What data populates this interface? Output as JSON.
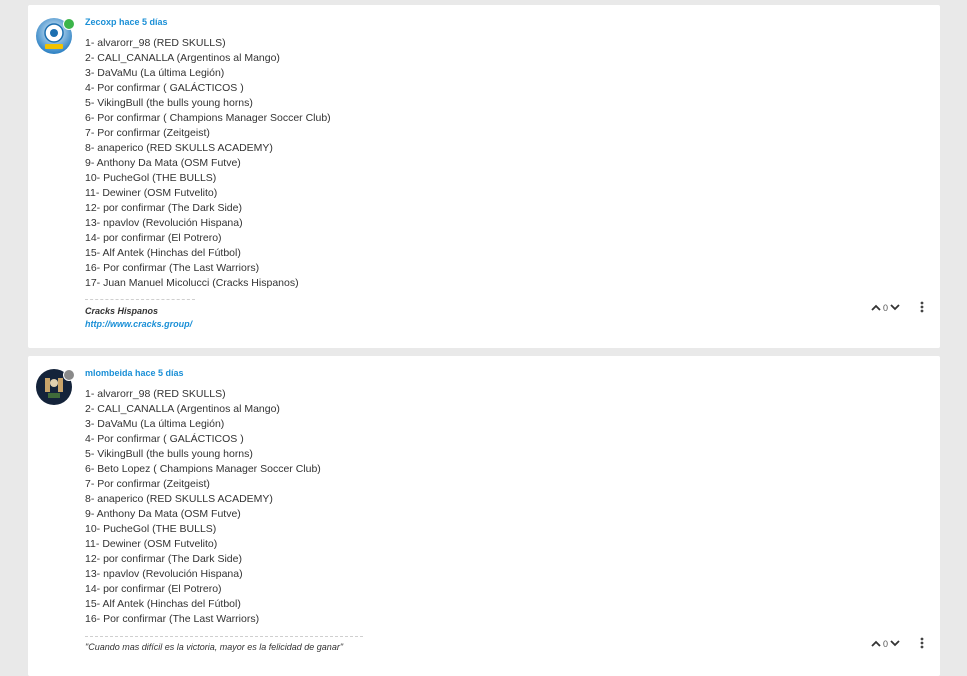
{
  "posts": [
    {
      "author": "Zecoxp",
      "time": "hace 5 días",
      "status_color": "#3cb54a",
      "lines": [
        "1- alvarorr_98 (RED SKULLS)",
        "2- CALI_CANALLA (Argentinos al Mango)",
        "3- DaVaMu (La última Legión)",
        "4- Por confirmar ( GALÁCTICOS )",
        "5- VikingBull (the bulls young horns)",
        "6- Por confirmar ( Champions Manager Soccer Club)",
        "7- Por confirmar (Zeitgeist)",
        "8- anaperico (RED SKULLS ACADEMY)",
        "9- Anthony Da Mata (OSM Futve)",
        "10- PucheGol (THE BULLS)",
        "11- Dewiner (OSM Futvelito)",
        "12- por confirmar (The Dark Side)",
        "13- npavlov (Revolución Hispana)",
        "14- por confirmar (El Potrero)",
        "15- Alf Antek (Hinchas del Fútbol)",
        "16- Por confirmar (The Last Warriors)",
        "17- Juan Manuel Micolucci (Cracks Hispanos)"
      ],
      "signature_name": "Cracks Hispanos",
      "signature_link": "http://www.cracks.group/",
      "votes": "0",
      "up_icon": "chevron-up-icon",
      "down_icon": "chevron-down-icon",
      "menu_icon": "more-vertical-icon"
    },
    {
      "author": "mlombeida",
      "time": "hace 5 días",
      "status_color": "#8a8a8a",
      "lines": [
        "1- alvarorr_98 (RED SKULLS)",
        "2- CALI_CANALLA (Argentinos al Mango)",
        "3- DaVaMu (La última Legión)",
        "4- Por confirmar ( GALÁCTICOS )",
        "5- VikingBull (the bulls young horns)",
        "6- Beto Lopez ( Champions Manager Soccer Club)",
        "7- Por confirmar (Zeitgeist)",
        "8- anaperico (RED SKULLS ACADEMY)",
        "9- Anthony Da Mata (OSM Futve)",
        "10- PucheGol (THE BULLS)",
        "11- Dewiner (OSM Futvelito)",
        "12- por confirmar (The Dark Side)",
        "13- npavlov (Revolución Hispana)",
        "14- por confirmar (El Potrero)",
        "15- Alf Antek (Hinchas del Fútbol)",
        "16- Por confirmar (The Last Warriors)"
      ],
      "signature_quote": "\"Cuando mas difícil es la victoria, mayor es la felicidad de ganar\"",
      "votes": "0",
      "up_icon": "chevron-up-icon",
      "down_icon": "chevron-down-icon",
      "menu_icon": "more-vertical-icon"
    }
  ]
}
